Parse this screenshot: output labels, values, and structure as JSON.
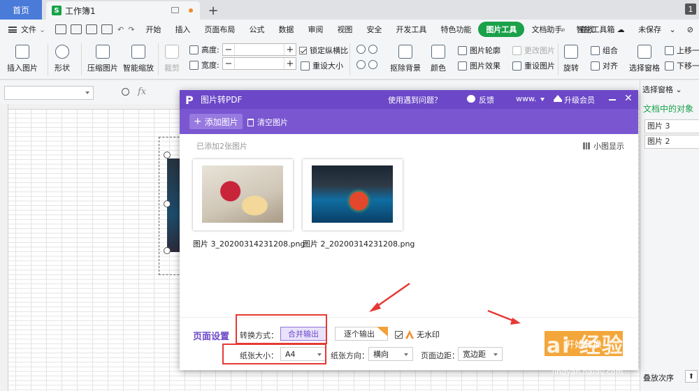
{
  "tabs": {
    "home": "首页",
    "doc": "工作簿1",
    "doc_logo": "S",
    "badge": "1"
  },
  "menu": {
    "file": "文件",
    "items": [
      "开始",
      "插入",
      "页面布局",
      "公式",
      "数据",
      "审阅",
      "视图",
      "安全",
      "开发工具",
      "特色功能",
      "图片工具",
      "文档助手",
      "智能工具箱"
    ],
    "active": "图片工具",
    "search": "查找",
    "unsaved": "未保存"
  },
  "ribbon": {
    "insert_picture": "插入图片",
    "shape": "形状",
    "compress": "压缩图片",
    "smart_zoom": "智能缩放",
    "crop": "裁剪",
    "height_label": "高度:",
    "width_label": "宽度:",
    "lock_ratio": "锁定纵横比",
    "reset_size": "重设大小",
    "remove_bg": "抠除背景",
    "color": "颜色",
    "picture_outline": "图片轮廓",
    "picture_effect": "图片效果",
    "change_picture": "更改图片",
    "reset_picture": "重设图片",
    "rotate": "旋转",
    "combine": "组合",
    "align": "对齐",
    "select_pane": "选择窗格",
    "move_up": "上移一",
    "move_down": "下移一"
  },
  "formula": {
    "fx": "fx"
  },
  "right_panel": {
    "title": "选择窗格",
    "subtitle": "文档中的对象",
    "items": [
      "图片 3",
      "图片 2"
    ],
    "bottom": "叠放次序"
  },
  "dialog": {
    "title": "图片转PDF",
    "logo": "P",
    "help": "使用遇到问题？",
    "feedback": "反馈",
    "account": "www.",
    "vip": "升级会员",
    "add_picture": "添加图片",
    "clear_picture": "清空图片",
    "added_count": "已添加2张图片",
    "thumb_mode": "小图显示",
    "images": [
      {
        "caption": "图片 3_20200314231208.png"
      },
      {
        "caption": "图片 2_20200314231208.png"
      }
    ],
    "page_settings": "页面设置",
    "convert_mode_label": "转换方式：",
    "merge_output": "合并输出",
    "each_output": "逐个输出",
    "no_watermark": "无水印",
    "paper_size_label": "纸张大小：",
    "paper_size_value": "A4",
    "orientation_label": "纸张方向：",
    "orientation_value": "横向",
    "margin_label": "页面边距：",
    "margin_value": "宽边距",
    "start_button": "开始转换"
  },
  "watermark": {
    "text": "Bai 经验",
    "url": "jingyan.baidu.com"
  },
  "colors": {
    "accent": "#6c48c8",
    "ribbon_active": "#1aa14a",
    "start": "#f3a63a",
    "annotation": "#e53935"
  }
}
